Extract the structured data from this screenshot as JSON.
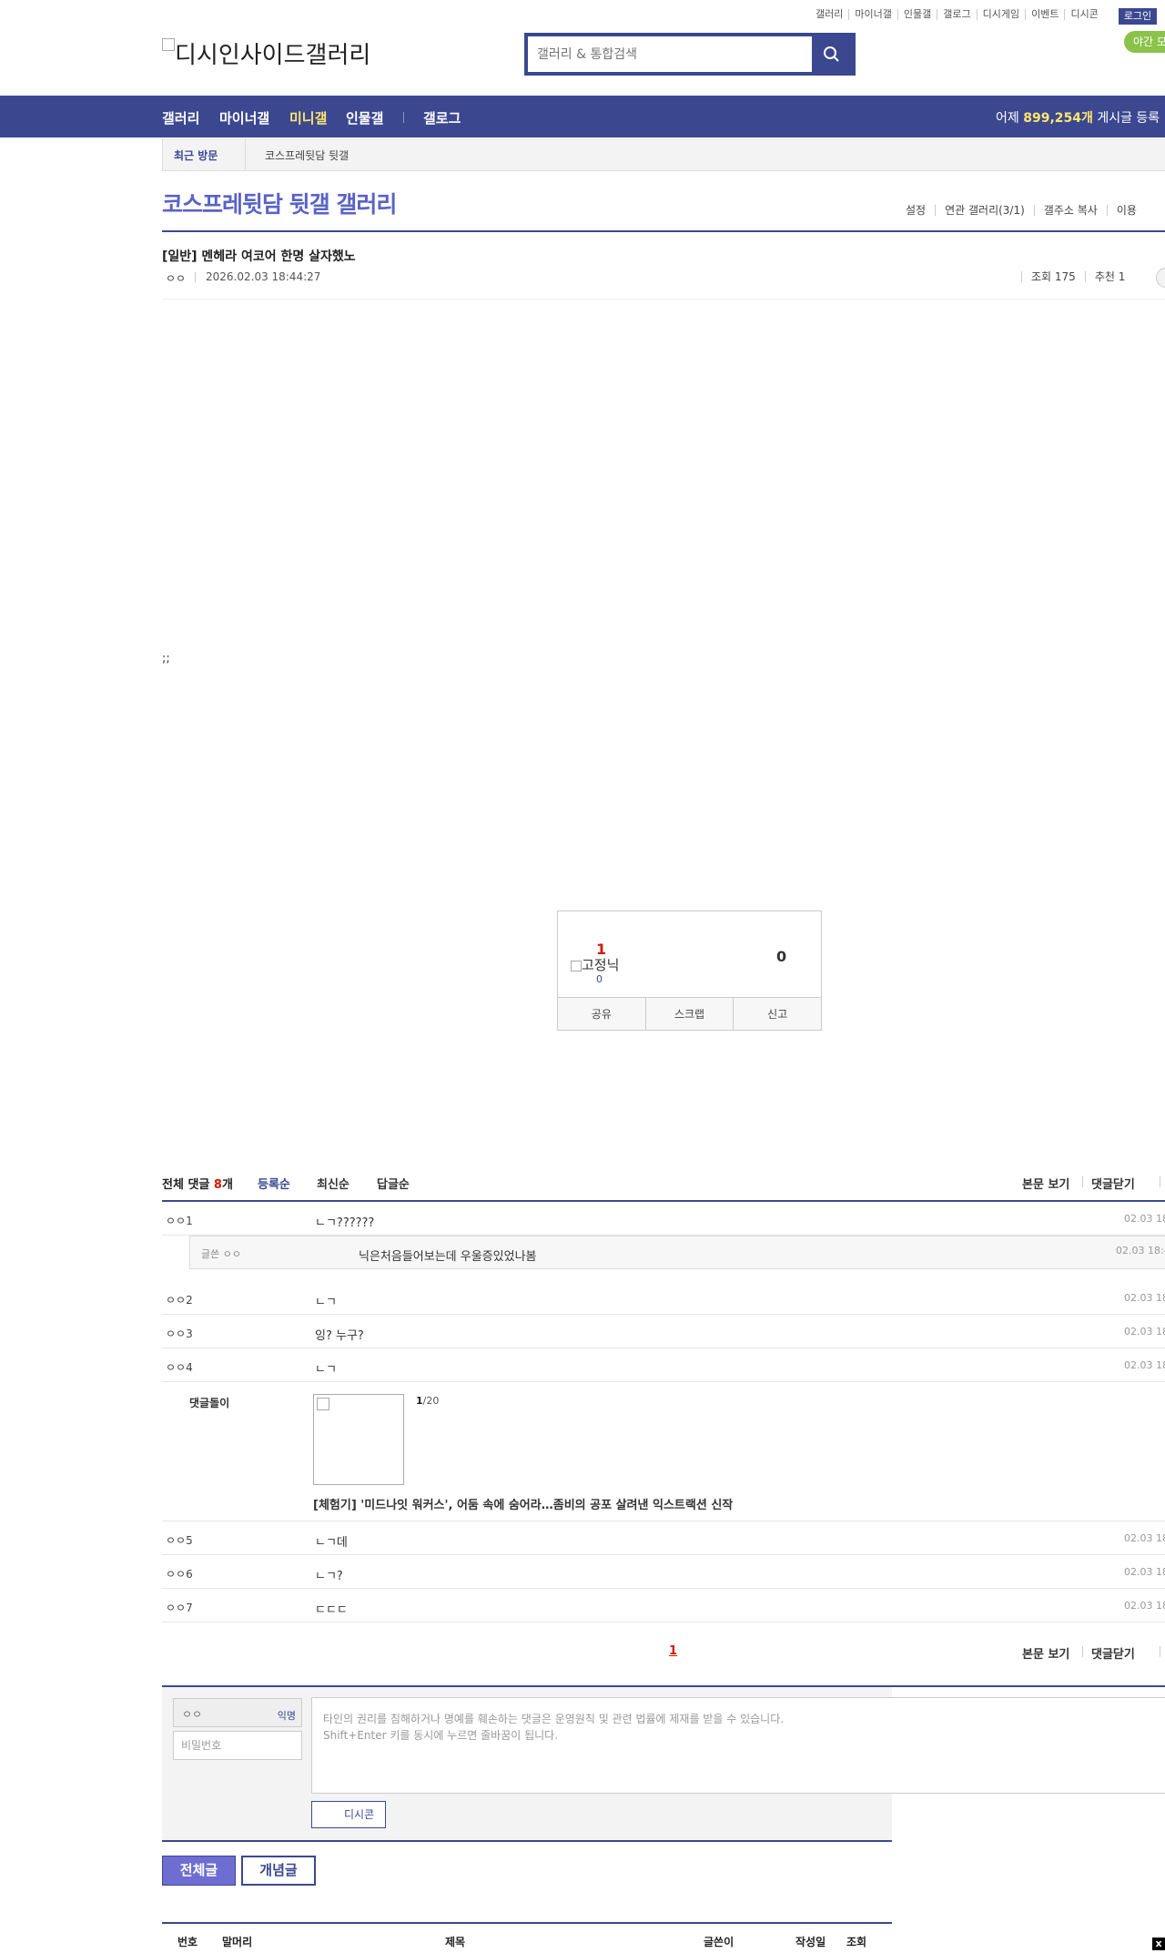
{
  "header": {
    "top_links": [
      "갤러리",
      "마이너갤",
      "인물갤",
      "갤로그",
      "디시게임",
      "이벤트",
      "디시콘"
    ],
    "login_label": "로그인",
    "night_label": "야간 모",
    "logo_text": "디시인사이드갤러리",
    "search_placeholder": "갤러리 & 통합검색"
  },
  "nav": {
    "items": [
      "갤러리",
      "마이너갤",
      "미니갤",
      "인물갤",
      "갤로그"
    ],
    "active_color": "#ffe66d",
    "stat_prefix": "어제 ",
    "stat_value": "899,254개",
    "stat_suffix": " 게시글 등록"
  },
  "recent": {
    "label": "최근 방문",
    "item": "코스프레뒷담 뒷갤"
  },
  "gallery": {
    "title": "코스프레뒷담 뒷갤 갤러리",
    "menu": [
      "설정",
      "연관 갤러리(3/1)",
      "갤주소 복사",
      "이용"
    ]
  },
  "post": {
    "title": "[일반] 멘헤라 여코어 한명 살자했노",
    "author": "ㅇㅇ",
    "date": "2026.02.03 18:44:27",
    "views": "조회 175",
    "recommend": "추천 1",
    "body": ";;"
  },
  "recommend_box": {
    "up_count": "1",
    "fixnick_alt": "고정닉",
    "fixnick_count": "0",
    "down_count": "0",
    "actions": [
      "공유",
      "스크랩",
      "신고"
    ]
  },
  "comments": {
    "header_prefix": "전체 댓글 ",
    "count": "8",
    "header_suffix": "개",
    "sorts": [
      "등록순",
      "최신순",
      "답글순"
    ],
    "right_links": [
      "본문 보기",
      "댓글닫기"
    ],
    "items": [
      {
        "nick": "ㅇㅇ1",
        "text": "ㄴㄱ??????",
        "date": "02.03 18"
      },
      {
        "nick": "ㅇㅇ2",
        "text": "ㄴㄱ",
        "date": "02.03 18"
      },
      {
        "nick": "ㅇㅇ3",
        "text": "잉? 누구?",
        "date": "02.03 18"
      },
      {
        "nick": "ㅇㅇ4",
        "text": "ㄴㄱ",
        "date": "02.03 18"
      },
      {
        "nick": "ㅇㅇ5",
        "text": "ㄴㄱ데",
        "date": "02.03 18"
      },
      {
        "nick": "ㅇㅇ6",
        "text": "ㄴㄱ?",
        "date": "02.03 18"
      },
      {
        "nick": "ㅇㅇ7",
        "text": "ㄷㄷㄷ",
        "date": "02.03 18"
      }
    ],
    "reply": {
      "nick": "글쓴 ㅇㅇ",
      "text": "닉은처음들어보는데 우울증있었나봄",
      "date": "02.03 18:4"
    },
    "ad": {
      "label": "댓글돌이",
      "page_current": "1",
      "page_total": "/20",
      "title": "[체험기] '미드나잇 워커스', 어둠 속에 숨어라…좀비의 공포 살려낸 익스트랙션 신작"
    },
    "pager": "1"
  },
  "write": {
    "nick": "ㅇㅇ",
    "anon_label": "익명",
    "password_placeholder": "비밀번호",
    "placeholder_line1": "타인의 권리를 침해하거나 명예를 훼손하는 댓글은 운영원칙 및 관련 법률에 제재를 받을 수 있습니다.",
    "placeholder_line2": "Shift+Enter 키를 동시에 누르면 줄바꿈이 됩니다.",
    "dccon_label": "디시콘"
  },
  "list_buttons": {
    "all": "전체글",
    "concept": "개념글"
  },
  "list_head": [
    "번호",
    "말머리",
    "제목",
    "글쓴이",
    "작성일",
    "조회"
  ],
  "close_label": "x"
}
